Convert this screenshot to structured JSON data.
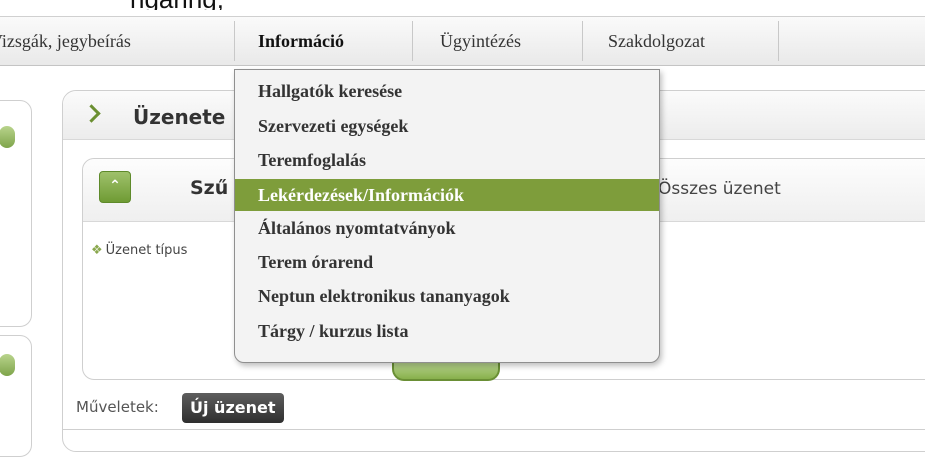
{
  "menubar": {
    "items": [
      {
        "label": "Vizsgák, jegybeírás"
      },
      {
        "label": "Információ"
      },
      {
        "label": "Ügyintézés"
      },
      {
        "label": "Szakdolgozat"
      }
    ],
    "active": "Információ"
  },
  "dropdown": {
    "items": [
      {
        "label": "Hallgatók keresése"
      },
      {
        "label": "Szervezeti egységek"
      },
      {
        "label": "Teremfoglalás"
      },
      {
        "label": "Lekérdezések/Információk",
        "highlighted": true
      },
      {
        "label": "Általános nyomtatványok"
      },
      {
        "label": "Terem órarend"
      },
      {
        "label": "Neptun elektronikus tananyagok"
      },
      {
        "label": "Tárgy / kurzus lista"
      }
    ],
    "highlight_color": "#7e9d3b"
  },
  "panel": {
    "title": "Üzenete"
  },
  "filter": {
    "title": "Szű",
    "all_messages": "Összes üzenet",
    "type_label": "Üzenet típus"
  },
  "actions": {
    "label": "Műveletek:",
    "new_message": "Új üzenet"
  },
  "top_partial_text": "ngaring,",
  "colors": {
    "accent_green": "#7e9d3b",
    "button_dark": "#3a3a3a"
  },
  "icons": {
    "panel_toggle": "chevron-right-icon",
    "filter_collapse": "double-chevron-up-icon",
    "type_bullet": "diamond-bullet-icon"
  }
}
